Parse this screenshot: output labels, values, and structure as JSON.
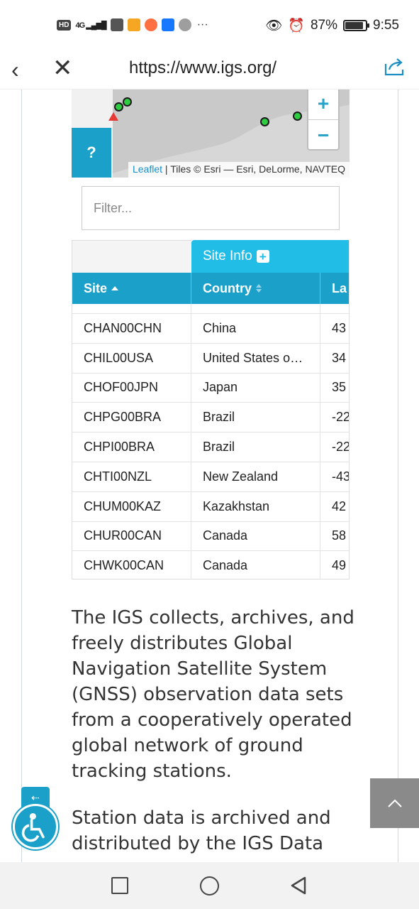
{
  "status_bar": {
    "network": "4G",
    "battery_percent": "87%",
    "time": "9:55"
  },
  "browser": {
    "url": "https://www.igs.org/"
  },
  "map": {
    "help_label": "?",
    "zoom_in_label": "+",
    "zoom_out_label": "−",
    "attribution_link": "Leaflet",
    "attribution_rest": " | Tiles © Esri — Esri, DeLorme, NAVTEQ"
  },
  "filter": {
    "placeholder": "Filter..."
  },
  "table": {
    "group_header": "Site Info",
    "columns": [
      "Site",
      "Country",
      "La"
    ],
    "rows": [
      {
        "site": "CHAN00CHN",
        "country": "China",
        "lat": "43"
      },
      {
        "site": "CHIL00USA",
        "country": "United States o…",
        "lat": "34"
      },
      {
        "site": "CHOF00JPN",
        "country": "Japan",
        "lat": "35"
      },
      {
        "site": "CHPG00BRA",
        "country": "Brazil",
        "lat": "-22"
      },
      {
        "site": "CHPI00BRA",
        "country": "Brazil",
        "lat": "-22"
      },
      {
        "site": "CHTI00NZL",
        "country": "New Zealand",
        "lat": "-43"
      },
      {
        "site": "CHUM00KAZ",
        "country": "Kazakhstan",
        "lat": "42"
      },
      {
        "site": "CHUR00CAN",
        "country": "Canada",
        "lat": "58"
      },
      {
        "site": "CHWK00CAN",
        "country": "Canada",
        "lat": "49"
      }
    ]
  },
  "content": {
    "paragraph1": "The IGS collects, archives, and freely distributes Global Navigation Satellite System (GNSS) observation data sets from a cooperatively operated global network of ground tracking stations.",
    "paragraph2": "Station data is archived and distributed by the IGS Data"
  },
  "colors": {
    "accent": "#1ba1c9",
    "accent_light": "#22bde7"
  }
}
